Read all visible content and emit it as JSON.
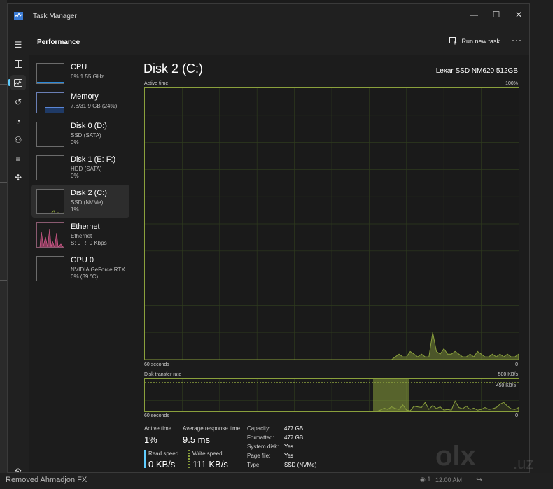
{
  "window": {
    "title": "Task Manager"
  },
  "header": {
    "page_title": "Performance",
    "run_new_task": "Run new task"
  },
  "devices": [
    {
      "name": "CPU",
      "line1": "6%  1.55 GHz",
      "line2": ""
    },
    {
      "name": "Memory",
      "line1": "7.8/31.9 GB (24%)",
      "line2": ""
    },
    {
      "name": "Disk 0 (D:)",
      "line1": "SSD (SATA)",
      "line2": "0%"
    },
    {
      "name": "Disk 1 (E: F:)",
      "line1": "HDD (SATA)",
      "line2": "0%"
    },
    {
      "name": "Disk 2 (C:)",
      "line1": "SSD (NVMe)",
      "line2": "1%"
    },
    {
      "name": "Ethernet",
      "line1": "Ethernet",
      "line2": "S: 0  R: 0 Kbps"
    },
    {
      "name": "GPU 0",
      "line1": "NVIDIA GeForce RTX…",
      "line2": "0% (39 °C)"
    }
  ],
  "main": {
    "title": "Disk 2 (C:)",
    "model": "Lexar SSD NM620 512GB",
    "active_time_graph": {
      "label": "Active time",
      "max": "100%",
      "x_left": "60 seconds",
      "x_right": "0"
    },
    "transfer_graph": {
      "label": "Disk transfer rate",
      "max": "500 KB/s",
      "marker": "450 KB/s",
      "x_left": "60 seconds",
      "x_right": "0"
    }
  },
  "stats": {
    "active_time_label": "Active time",
    "active_time_value": "1%",
    "avg_response_label": "Average response time",
    "avg_response_value": "9.5 ms",
    "read_speed_label": "Read speed",
    "read_speed_value": "0 KB/s",
    "write_speed_label": "Write speed",
    "write_speed_value": "111 KB/s"
  },
  "details": [
    {
      "key": "Capacity:",
      "value": "477 GB"
    },
    {
      "key": "Formatted:",
      "value": "477 GB"
    },
    {
      "key": "System disk:",
      "value": "Yes"
    },
    {
      "key": "Page file:",
      "value": "Yes"
    },
    {
      "key": "Type:",
      "value": "SSD (NVMe)"
    }
  ],
  "background": {
    "bottom_text": "Removed Ahmadjon FX",
    "time": "12:00 AM",
    "watermark": "olx",
    "watermark_suffix": ".uz"
  },
  "colors": {
    "disk_green": "#8aa03c",
    "ethernet_pink": "#d05a8a",
    "cpu_blue": "#2b88d8",
    "accent": "#60cdff"
  },
  "active_time_series": [
    0,
    0,
    0,
    0,
    0,
    0,
    0,
    0,
    0,
    0,
    0,
    0,
    0,
    0,
    0,
    0,
    0,
    0,
    0,
    0,
    0,
    0,
    0,
    0,
    0,
    0,
    0,
    0,
    0,
    0,
    0,
    0,
    0,
    0,
    0,
    0,
    0,
    0,
    0,
    0,
    0,
    0,
    0,
    0,
    0,
    0,
    0,
    0,
    0,
    0,
    0,
    0,
    0,
    0,
    0,
    0,
    0,
    0,
    0,
    0,
    0,
    0,
    0,
    0,
    0,
    0,
    0,
    1,
    2,
    1,
    1,
    3,
    2,
    1,
    2,
    1,
    1,
    10,
    3,
    2,
    4,
    2,
    2,
    3,
    2,
    1,
    1,
    2,
    1,
    3,
    2,
    1,
    1,
    2,
    1,
    2,
    1,
    2,
    1,
    1,
    2
  ],
  "transfer_series": [
    0,
    0,
    0,
    0,
    0,
    0,
    0,
    0,
    0,
    0,
    0,
    0,
    0,
    0,
    0,
    0,
    0,
    0,
    0,
    0,
    0,
    0,
    0,
    0,
    0,
    0,
    0,
    0,
    0,
    0,
    0,
    0,
    0,
    0,
    0,
    0,
    0,
    0,
    0,
    0,
    0,
    0,
    0,
    0,
    0,
    0,
    0,
    0,
    0,
    0,
    0,
    0,
    0,
    0,
    0,
    0,
    0,
    0,
    0,
    0,
    0,
    0,
    0,
    20,
    50,
    30,
    70,
    45,
    30,
    100,
    20,
    10,
    80,
    70,
    60,
    140,
    30,
    90,
    45,
    70,
    20,
    30,
    20,
    160,
    60,
    40,
    80,
    30,
    50,
    20,
    30,
    60,
    30,
    40,
    60,
    110,
    140,
    80,
    40,
    30,
    60
  ]
}
